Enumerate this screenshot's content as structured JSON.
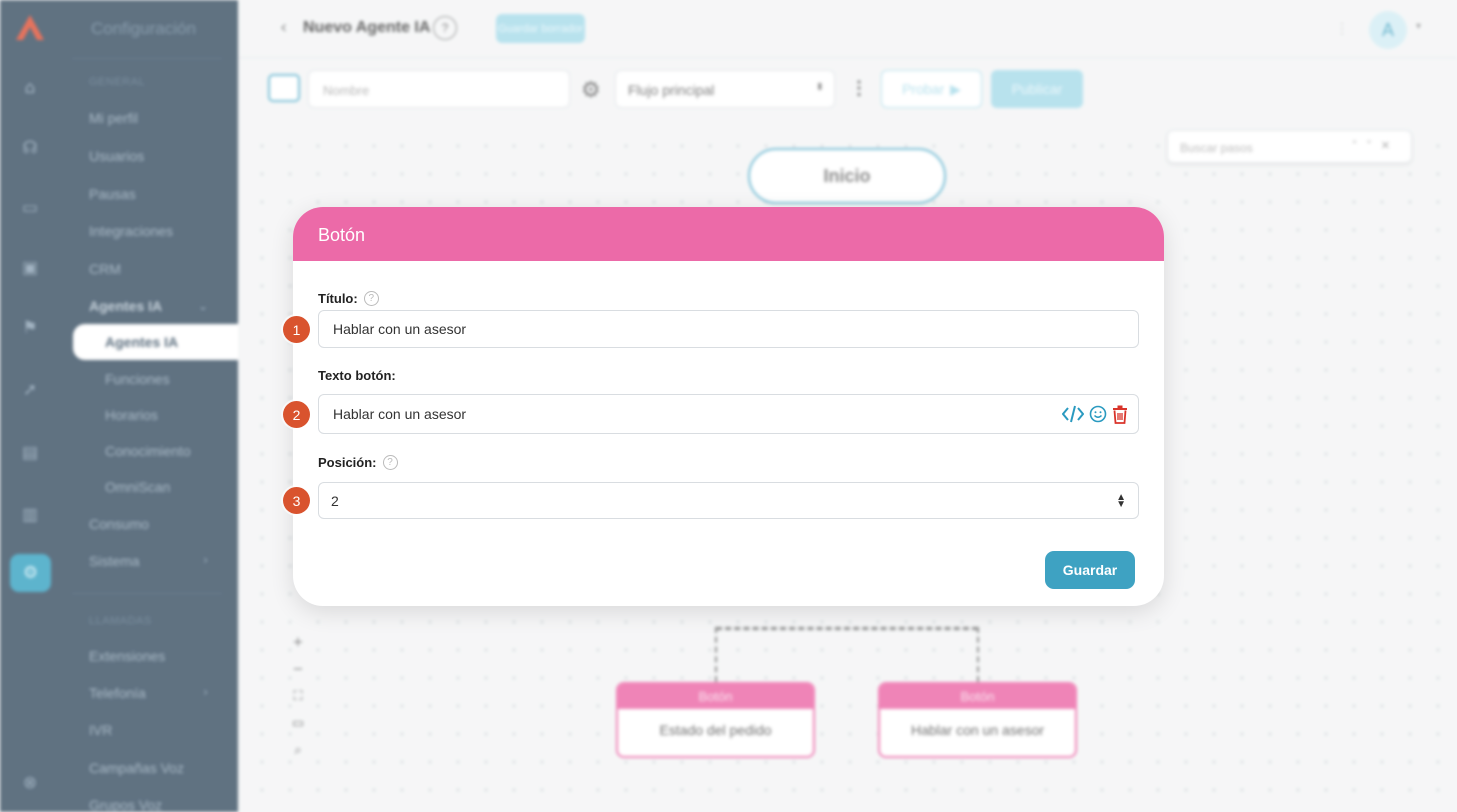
{
  "sidebar": {
    "title": "Configuración",
    "section_general": "GENERAL",
    "items": [
      {
        "label": "Mi perfil"
      },
      {
        "label": "Usuarios"
      },
      {
        "label": "Pausas"
      },
      {
        "label": "Integraciones"
      },
      {
        "label": "CRM"
      },
      {
        "label": "Agentes IA"
      }
    ],
    "subitems": [
      {
        "label": "Agentes IA"
      },
      {
        "label": "Funciones"
      },
      {
        "label": "Horarios"
      },
      {
        "label": "Conocimiento"
      },
      {
        "label": "OmniScan"
      }
    ],
    "items2": [
      {
        "label": "Consumo"
      },
      {
        "label": "Sistema"
      }
    ],
    "section_llamadas": "LLAMADAS",
    "items3": [
      {
        "label": "Extensiones"
      },
      {
        "label": "Telefonía"
      },
      {
        "label": "IVR"
      },
      {
        "label": "Campañas Voz"
      },
      {
        "label": "Grupos Voz"
      }
    ]
  },
  "header": {
    "title": "Nuevo Agente IA",
    "help": "?",
    "badge": "Guardar borrador",
    "avatar": "A"
  },
  "toolbar": {
    "name_placeholder": "Nombre",
    "flow": "Flujo principal",
    "test_label": "Probar",
    "publish_label": "Publicar"
  },
  "canvas": {
    "search_placeholder": "Buscar pasos",
    "start_node": "Inicio",
    "nodes": [
      {
        "header": "Botón",
        "text": "Estado del pedido"
      },
      {
        "header": "Botón",
        "text": "Hablar con un asesor"
      }
    ]
  },
  "modal": {
    "title": "Botón",
    "title_label": "Título:",
    "title_value": "Hablar con un asesor",
    "button_text_label": "Texto botón:",
    "button_text_value": "Hablar con un asesor",
    "position_label": "Posición:",
    "position_value": "2",
    "save_label": "Guardar"
  },
  "steps": [
    "1",
    "2",
    "3"
  ],
  "colors": {
    "accent": "#3ea2c2",
    "node_pink": "#ec6aa8",
    "step_badge": "#d9532e",
    "sidebar_bg": "#3d5366",
    "code_icon": "#2a9ac0",
    "trash_icon": "#d9342b"
  }
}
